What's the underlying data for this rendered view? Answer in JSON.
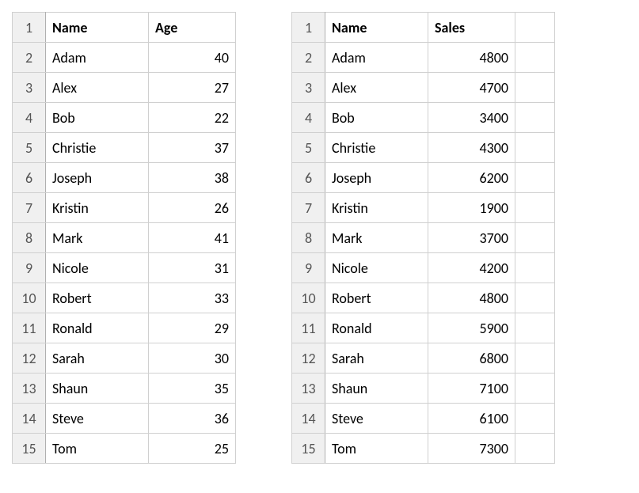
{
  "table_left": {
    "headers": {
      "name": "Name",
      "value": "Age"
    },
    "rows": [
      {
        "name": "Adam",
        "value": "40"
      },
      {
        "name": "Alex",
        "value": "27"
      },
      {
        "name": "Bob",
        "value": "22"
      },
      {
        "name": "Christie",
        "value": "37"
      },
      {
        "name": "Joseph",
        "value": "38"
      },
      {
        "name": "Kristin",
        "value": "26"
      },
      {
        "name": "Mark",
        "value": "41"
      },
      {
        "name": "Nicole",
        "value": "31"
      },
      {
        "name": "Robert",
        "value": "33"
      },
      {
        "name": "Ronald",
        "value": "29"
      },
      {
        "name": "Sarah",
        "value": "30"
      },
      {
        "name": "Shaun",
        "value": "35"
      },
      {
        "name": "Steve",
        "value": "36"
      },
      {
        "name": "Tom",
        "value": "25"
      }
    ]
  },
  "table_right": {
    "headers": {
      "name": "Name",
      "value": "Sales"
    },
    "rows": [
      {
        "name": "Adam",
        "value": "4800"
      },
      {
        "name": "Alex",
        "value": "4700"
      },
      {
        "name": "Bob",
        "value": "3400"
      },
      {
        "name": "Christie",
        "value": "4300"
      },
      {
        "name": "Joseph",
        "value": "6200"
      },
      {
        "name": "Kristin",
        "value": "1900"
      },
      {
        "name": "Mark",
        "value": "3700"
      },
      {
        "name": "Nicole",
        "value": "4200"
      },
      {
        "name": "Robert",
        "value": "4800"
      },
      {
        "name": "Ronald",
        "value": "5900"
      },
      {
        "name": "Sarah",
        "value": "6800"
      },
      {
        "name": "Shaun",
        "value": "7100"
      },
      {
        "name": "Steve",
        "value": "6100"
      },
      {
        "name": "Tom",
        "value": "7300"
      }
    ]
  },
  "row_numbers": [
    "1",
    "2",
    "3",
    "4",
    "5",
    "6",
    "7",
    "8",
    "9",
    "10",
    "11",
    "12",
    "13",
    "14",
    "15"
  ]
}
